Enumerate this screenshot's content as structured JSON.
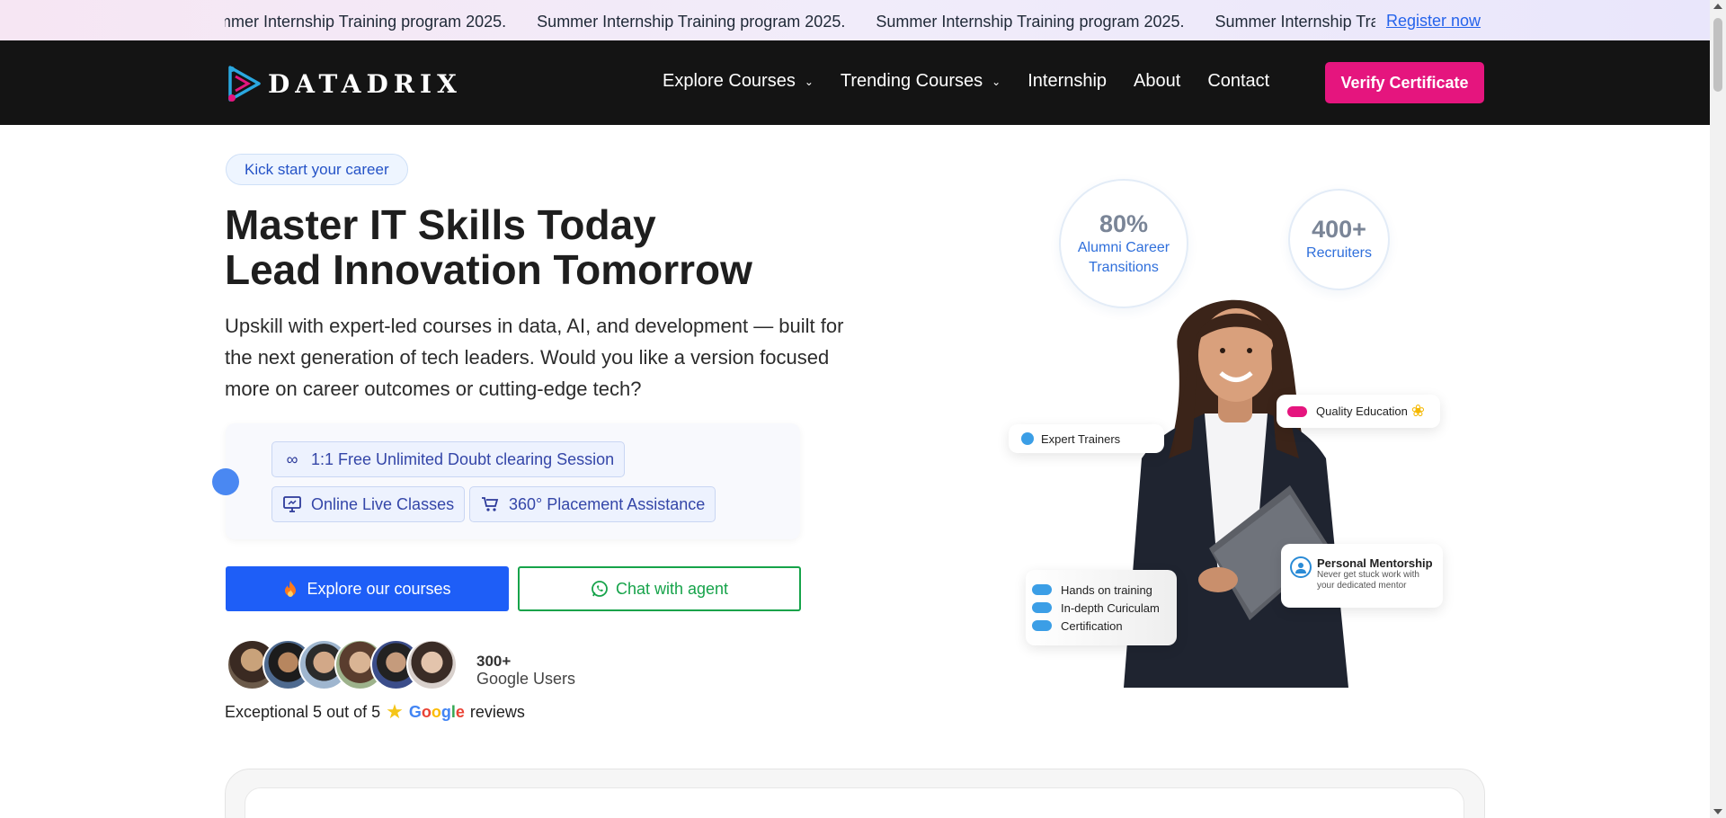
{
  "ticker": {
    "items": [
      "Summer Internship Training program 2025.",
      "Summer Internship Training program 2025.",
      "Summer Internship Training program 2025.",
      "Summer Internship Training program 2025."
    ],
    "register_link": "Register now"
  },
  "nav": {
    "logo_text": "DATADRIX",
    "links": [
      {
        "label": "Explore Courses",
        "has_dropdown": true
      },
      {
        "label": "Trending Courses",
        "has_dropdown": true
      },
      {
        "label": "Internship",
        "has_dropdown": false
      },
      {
        "label": "About",
        "has_dropdown": false
      },
      {
        "label": "Contact",
        "has_dropdown": false
      }
    ],
    "verify_button": "Verify Certificate"
  },
  "hero": {
    "badge": "Kick start your career",
    "title_line1": "Master IT Skills Today",
    "title_line2": "Lead Innovation Tomorrow",
    "subtitle": "Upskill with expert-led courses in data, AI, and development — built for the next generation of tech leaders. Would you like a version focused more on career outcomes or cutting-edge tech?",
    "features": [
      {
        "icon": "infinity-icon",
        "label": "1:1 Free Unlimited Doubt clearing Session"
      },
      {
        "icon": "monitor-icon",
        "label": "Online Live Classes"
      },
      {
        "icon": "cart-icon",
        "label": "360° Placement Assistance"
      }
    ],
    "explore_button": "Explore our courses",
    "chat_button": "Chat with agent",
    "users_count": "300+",
    "users_label": "Google Users",
    "review_prefix": "Exceptional 5 out of 5",
    "review_suffix": "reviews",
    "google_letters": [
      "G",
      "o",
      "o",
      "g",
      "l",
      "e"
    ]
  },
  "stats": [
    {
      "value": "80%",
      "label": "Alumni Career Transitions"
    },
    {
      "value": "400+",
      "label": "Recruiters"
    }
  ],
  "floating_cards": {
    "expert_trainers": "Expert Trainers",
    "quality_education": "Quality Education",
    "checklist": [
      "Hands on training",
      "In-depth Curiculam",
      "Certification"
    ],
    "mentorship_title": "Personal Mentorship",
    "mentorship_desc": "Never get stuck work with your dedicated mentor"
  },
  "colors": {
    "brand_pink": "#e5157e",
    "primary_blue": "#1e5ef7",
    "whatsapp_green": "#16a34a",
    "nav_bg": "#141414",
    "google_blue": "#4285F4",
    "google_red": "#EA4335",
    "google_yellow": "#FBBC05",
    "google_green": "#34A853"
  }
}
